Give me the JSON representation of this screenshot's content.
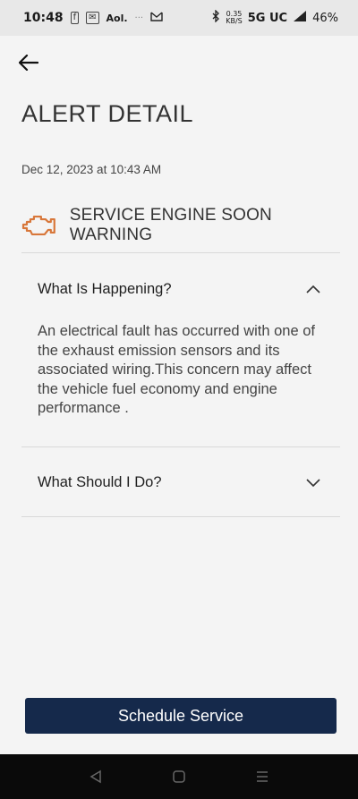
{
  "status_bar": {
    "time": "10:48",
    "icons_left": [
      "fb-icon",
      "chat-icon",
      "volte-icon",
      "dots-icon",
      "gmail-icon"
    ],
    "left_text": "Aol.",
    "bluetooth": "bluetooth-icon",
    "speed_top": "0.35",
    "speed_bottom": "KB/S",
    "network": "5G UC",
    "battery": "46%"
  },
  "header": {
    "back_icon": "back-arrow-icon",
    "title": "ALERT DETAIL"
  },
  "alert": {
    "timestamp": "Dec 12, 2023 at 10:43 AM",
    "icon": "engine-warning-icon",
    "icon_color": "#d8773a",
    "title": "SERVICE ENGINE SOON WARNING"
  },
  "sections": [
    {
      "label": "What Is Happening?",
      "expanded": true,
      "body": "An electrical fault has occurred with one of the exhaust emission sensors and its associated wiring.This concern may affect the vehicle fuel economy and engine performance ."
    },
    {
      "label": "What Should I Do?",
      "expanded": false
    }
  ],
  "actions": {
    "schedule_label": "Schedule Service",
    "schedule_color": "#15294b"
  },
  "nav": {
    "back": "nav-back-icon",
    "home": "nav-home-icon",
    "recents": "nav-recents-icon"
  }
}
